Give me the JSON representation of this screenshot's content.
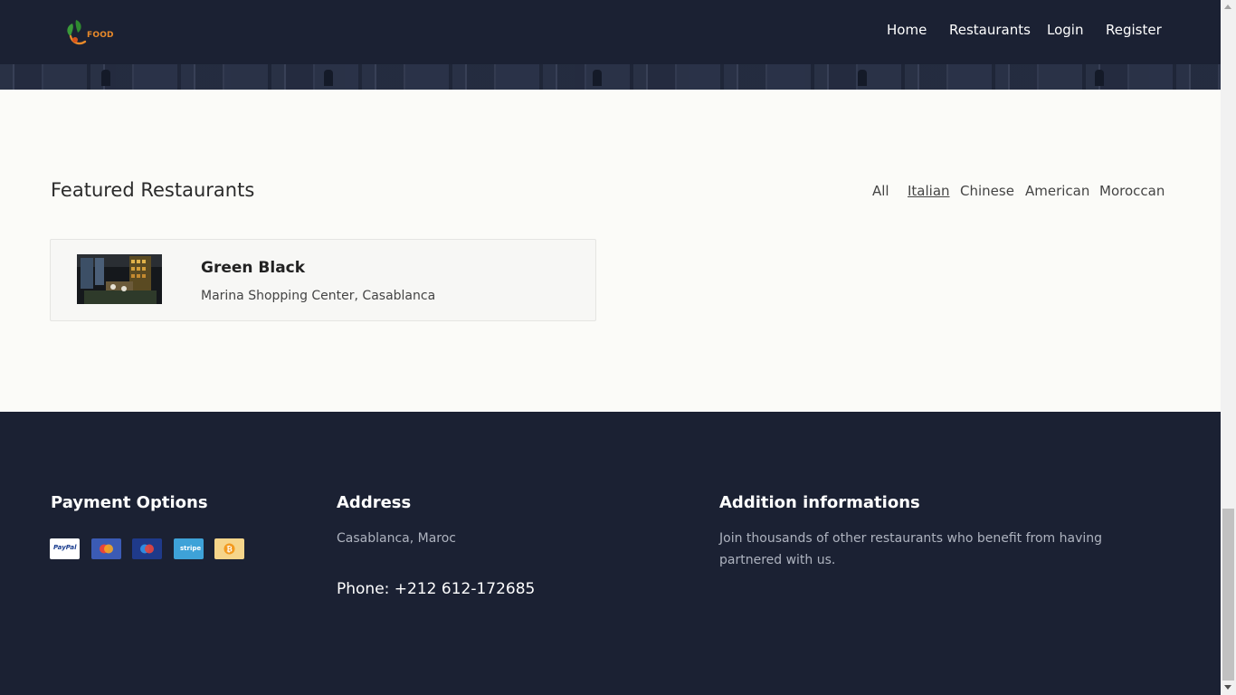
{
  "header": {
    "logo_text": "FOOD",
    "nav": [
      {
        "label": "Home"
      },
      {
        "label": "Restaurants"
      },
      {
        "label": "Login"
      },
      {
        "label": "Register"
      }
    ]
  },
  "main": {
    "title": "Featured Restaurants",
    "filters": [
      {
        "label": "All",
        "active": false
      },
      {
        "label": "Italian",
        "active": true
      },
      {
        "label": "Chinese",
        "active": false
      },
      {
        "label": "American",
        "active": false
      },
      {
        "label": "Moroccan",
        "active": false
      }
    ],
    "restaurants": [
      {
        "name": "Green Black",
        "address": "Marina Shopping Center, Casablanca"
      }
    ]
  },
  "footer": {
    "payment": {
      "title": "Payment Options",
      "methods": [
        {
          "icon": "paypal-icon",
          "label": "PayPal",
          "color": "#ffffff"
        },
        {
          "icon": "mastercard-icon",
          "label": "",
          "color": "#3b5bb5"
        },
        {
          "icon": "maestro-icon",
          "label": "",
          "color": "#1f3a8a"
        },
        {
          "icon": "stripe-icon",
          "label": "stripe",
          "color": "#3ea2d8"
        },
        {
          "icon": "bitcoin-icon",
          "label": "",
          "color": "#f6d58a"
        }
      ]
    },
    "address": {
      "title": "Address",
      "text": "Casablanca, Maroc",
      "phone": "Phone: +212 612-172685"
    },
    "info": {
      "title": "Addition informations",
      "text": "Join thousands of other restaurants who benefit from having partnered with us."
    }
  },
  "colors": {
    "dark_bg": "#1b2133",
    "page_bg": "#fbfbf8",
    "logo_orange": "#e98a2a",
    "logo_green": "#3a9a3a"
  }
}
